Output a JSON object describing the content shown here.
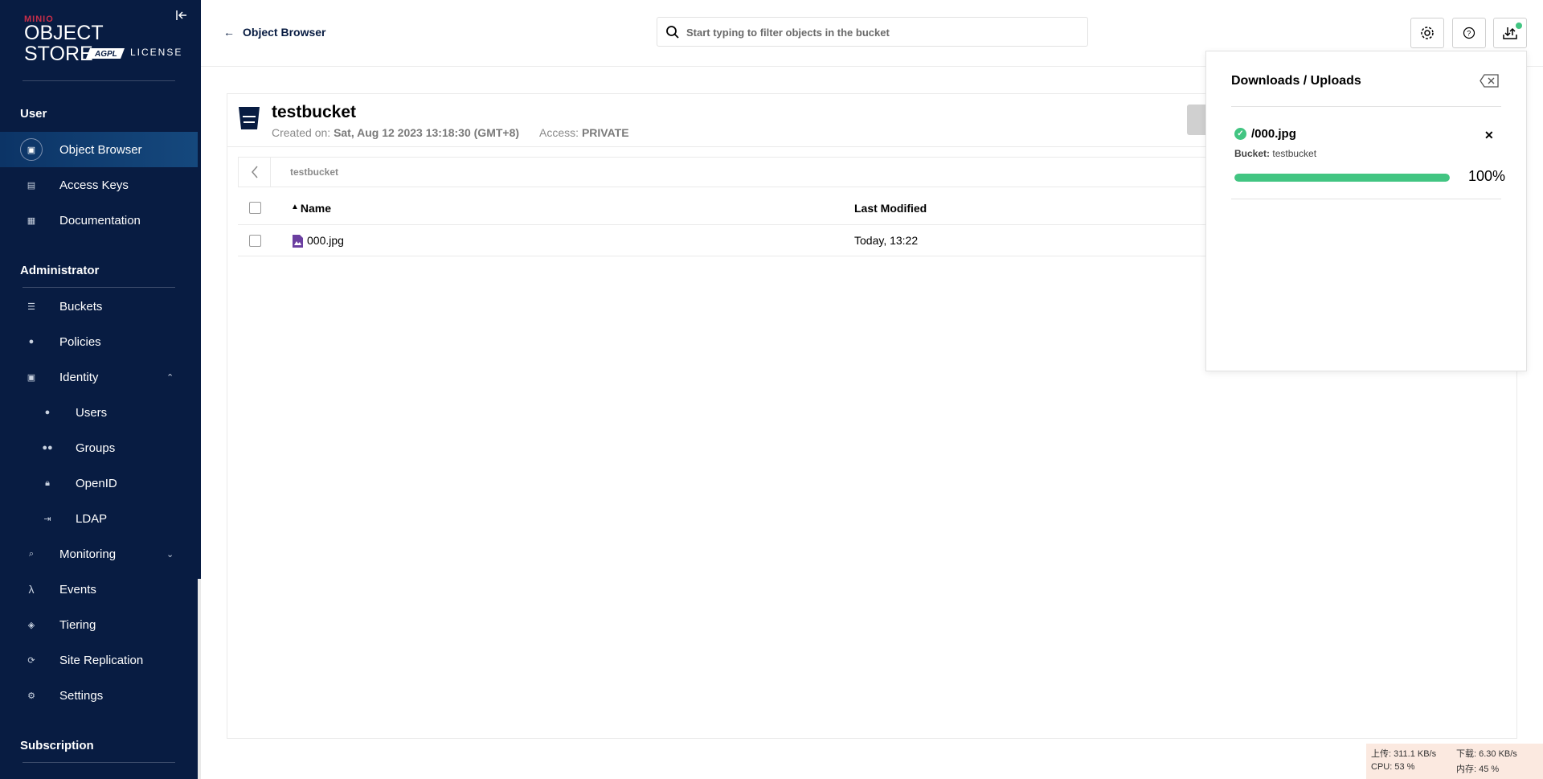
{
  "sidebar": {
    "logo": {
      "brand": "MINIO",
      "product": "OBJECT STORE",
      "badge": "AGPL",
      "license": "LICENSE"
    },
    "sections": {
      "user": "User",
      "administrator": "Administrator",
      "subscription": "Subscription"
    },
    "items": {
      "object_browser": "Object Browser",
      "access_keys": "Access Keys",
      "documentation": "Documentation",
      "buckets": "Buckets",
      "policies": "Policies",
      "identity": "Identity",
      "users": "Users",
      "groups": "Groups",
      "openid": "OpenID",
      "ldap": "LDAP",
      "monitoring": "Monitoring",
      "events": "Events",
      "tiering": "Tiering",
      "site_replication": "Site Replication",
      "settings": "Settings"
    }
  },
  "topbar": {
    "back_label": "Object Browser",
    "search_placeholder": "Start typing to filter objects in the bucket"
  },
  "bucket": {
    "name": "testbucket",
    "created_label": "Created on:",
    "created_value": "Sat, Aug 12 2023 13:18:30 (GMT+8)",
    "access_label": "Access:",
    "access_value": "PRIVATE",
    "path": "testbucket"
  },
  "table": {
    "headers": {
      "name": "Name",
      "modified": "Last Modified"
    },
    "rows": [
      {
        "name": "000.jpg",
        "modified": "Today, 13:22"
      }
    ]
  },
  "downloads": {
    "title": "Downloads / Uploads",
    "file": "/000.jpg",
    "bucket_label": "Bucket:",
    "bucket_value": "testbucket",
    "progress": 100,
    "progress_text": "100%"
  },
  "tray": {
    "upload": "上传: 311.1 KB/s",
    "download": "下载: 6.30 KB/s",
    "cpu": "CPU: 53 %",
    "mem": "内存: 45 %"
  },
  "colors": {
    "sidebar": "#081c42",
    "accent": "#42c582",
    "brand_red": "#c72e49"
  }
}
